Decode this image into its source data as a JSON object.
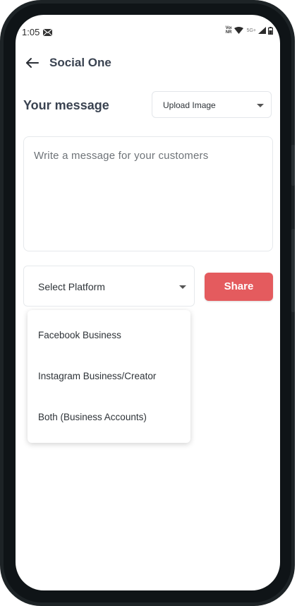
{
  "status_bar": {
    "time": "1:05",
    "volte_line1": "Voı",
    "volte_line2": "NR",
    "network": "5G+"
  },
  "header": {
    "title": "Social One"
  },
  "message_section": {
    "label": "Your message",
    "upload_select_value": "Upload Image",
    "message_placeholder": "Write a message for your customers"
  },
  "platform": {
    "select_value": "Select Platform",
    "options": [
      "Facebook Business",
      "Instagram Business/Creator",
      "Both (Business Accounts)"
    ]
  },
  "share_button": {
    "label": "Share"
  },
  "colors": {
    "accent": "#e45b5e",
    "title_text": "#3a4351",
    "frame": "#1d2326"
  }
}
